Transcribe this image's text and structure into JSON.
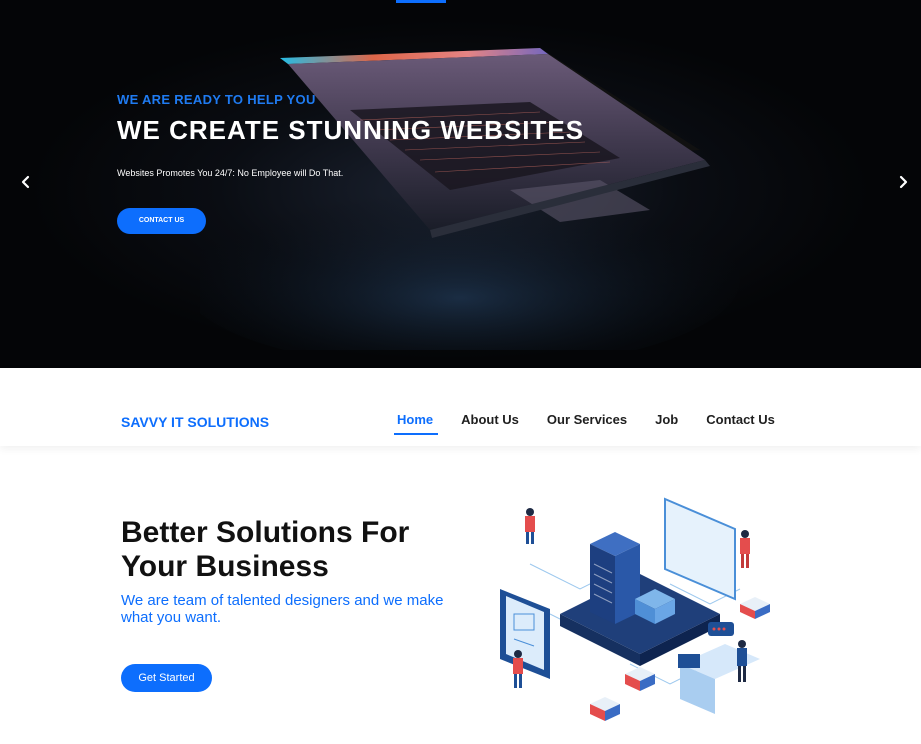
{
  "hero": {
    "eyebrow": "WE ARE READY TO HELP YOU",
    "title": "WE CREATE STUNNING WEBSITES",
    "subtitle": "Websites Promotes You 24/7: No Employee will Do That.",
    "cta_label": "CONTACT US",
    "prev_icon": "chevron-left-icon",
    "next_icon": "chevron-right-icon"
  },
  "nav": {
    "brand": "SAVVY IT SOLUTIONS",
    "links": [
      {
        "label": "Home",
        "active": true
      },
      {
        "label": "About Us",
        "active": false
      },
      {
        "label": "Our Services",
        "active": false
      },
      {
        "label": "Job",
        "active": false
      },
      {
        "label": "Contact Us",
        "active": false
      }
    ]
  },
  "intro": {
    "title_line1": "Better Solutions For",
    "title_line2": "Your Business",
    "subtitle": "We are team of talented designers and we make what you want.",
    "cta_label": "Get Started"
  },
  "colors": {
    "accent": "#0d6efd",
    "hero_bg": "#0a0d13",
    "text_dark": "#111111"
  }
}
